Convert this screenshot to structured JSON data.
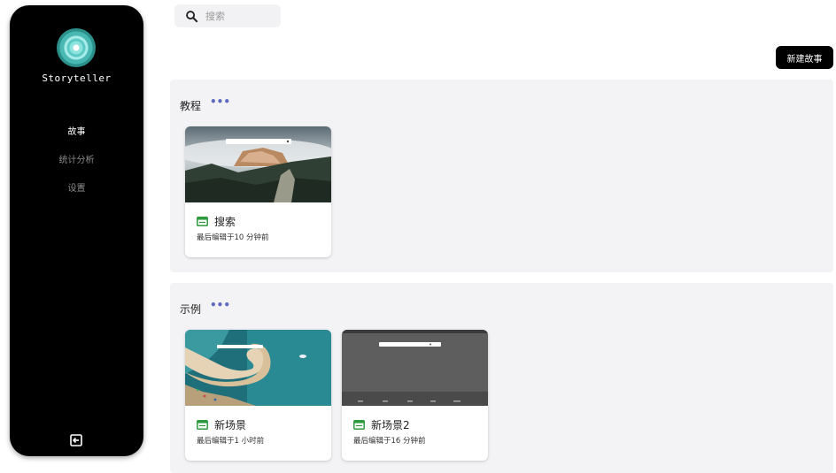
{
  "sidebar": {
    "brand": "Storyteller",
    "nav": [
      {
        "label": "故事",
        "active": true
      },
      {
        "label": "统计分析",
        "active": false
      },
      {
        "label": "设置",
        "active": false
      }
    ]
  },
  "search": {
    "placeholder": "搜索"
  },
  "toolbar": {
    "new_story_label": "新建故事"
  },
  "sections": [
    {
      "title": "教程",
      "cards": [
        {
          "title": "搜索",
          "subtitle": "最后编辑于10 分钟前",
          "thumbnail": "mountain-fog-landscape"
        }
      ]
    },
    {
      "title": "示例",
      "cards": [
        {
          "title": "新场景",
          "subtitle": "最后编辑于1 小时前",
          "thumbnail": "aerial-beach-spiral"
        },
        {
          "title": "新场景2",
          "subtitle": "最后编辑于16 分钟前",
          "thumbnail": "dark-grey-desktop"
        }
      ]
    }
  ],
  "colors": {
    "accent": "#5c6bc0",
    "card_icon": "#2e9a3e",
    "sidebar_bg": "#000000",
    "section_bg": "#f3f3f5"
  }
}
